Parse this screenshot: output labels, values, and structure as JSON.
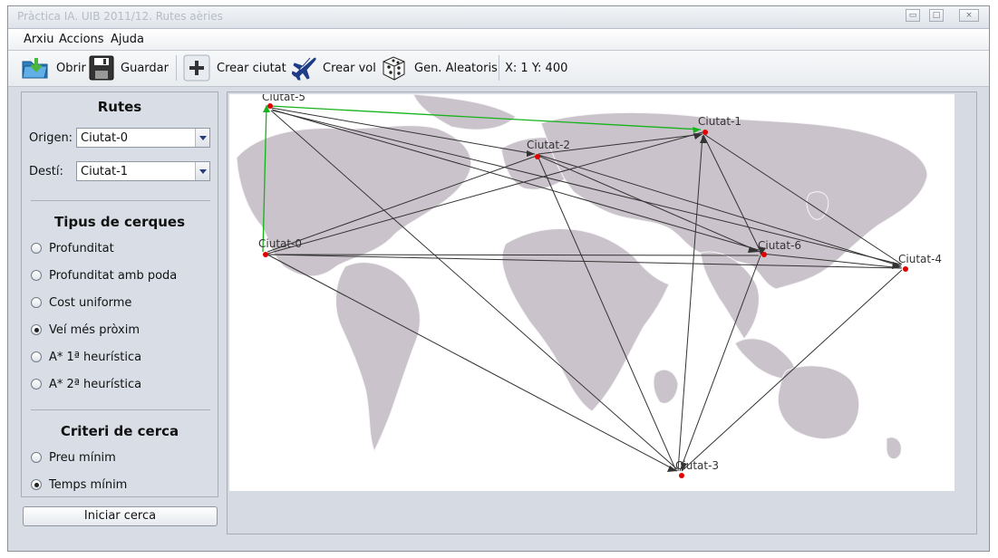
{
  "window": {
    "title": "Pràctica IA. UIB 2011/12. Rutes aèries",
    "controls": [
      "minimize",
      "maximize",
      "close"
    ]
  },
  "menu": [
    {
      "label": "Arxiu"
    },
    {
      "label": "Accions"
    },
    {
      "label": "Ajuda"
    }
  ],
  "toolbar": {
    "open_label": "Obrir",
    "save_label": "Guardar",
    "create_city_label": "Crear ciutat",
    "create_flight_label": "Crear vol",
    "random_label": "Gen. Aleatoris",
    "coordinates": "X: 1 Y: 400"
  },
  "sidebar": {
    "routes_title": "Rutes",
    "origin_label": "Origen:",
    "origin_value": "Ciutat-0",
    "destination_label": "Destí:",
    "destination_value": "Ciutat-1",
    "search_types_title": "Tipus de cerques",
    "search_types": [
      {
        "label": "Profunditat",
        "selected": false
      },
      {
        "label": "Profunditat amb poda",
        "selected": false
      },
      {
        "label": "Cost uniforme",
        "selected": false
      },
      {
        "label": "Veí més pròxim",
        "selected": true
      },
      {
        "label": "A* 1ª heurística",
        "selected": false
      },
      {
        "label": "A* 2ª heurística",
        "selected": false
      }
    ],
    "criteria_title": "Criteri de cerca",
    "criteria": [
      {
        "label": "Preu mínim",
        "selected": false
      },
      {
        "label": "Temps mínim",
        "selected": true
      }
    ],
    "start_button": "Iniciar cerca"
  },
  "map": {
    "cities": [
      {
        "label": "Ciutat-0"
      },
      {
        "label": "Ciutat-1"
      },
      {
        "label": "Ciutat-2"
      },
      {
        "label": "Ciutat-3"
      },
      {
        "label": "Ciutat-4"
      },
      {
        "label": "Ciutat-5"
      },
      {
        "label": "Ciutat-6"
      }
    ],
    "routes": [
      {
        "from": "Ciutat-0",
        "to": "Ciutat-5",
        "highlighted": true
      },
      {
        "from": "Ciutat-5",
        "to": "Ciutat-1",
        "highlighted": true
      },
      {
        "from": "Ciutat-5",
        "to": "Ciutat-2",
        "highlighted": false
      },
      {
        "from": "Ciutat-5",
        "to": "Ciutat-6",
        "highlighted": false
      },
      {
        "from": "Ciutat-5",
        "to": "Ciutat-4",
        "highlighted": false
      },
      {
        "from": "Ciutat-5",
        "to": "Ciutat-3",
        "highlighted": false
      },
      {
        "from": "Ciutat-0",
        "to": "Ciutat-2",
        "highlighted": false
      },
      {
        "from": "Ciutat-0",
        "to": "Ciutat-1",
        "highlighted": false
      },
      {
        "from": "Ciutat-0",
        "to": "Ciutat-6",
        "highlighted": false
      },
      {
        "from": "Ciutat-0",
        "to": "Ciutat-4",
        "highlighted": false
      },
      {
        "from": "Ciutat-0",
        "to": "Ciutat-3",
        "highlighted": false
      },
      {
        "from": "Ciutat-2",
        "to": "Ciutat-1",
        "highlighted": false
      },
      {
        "from": "Ciutat-2",
        "to": "Ciutat-6",
        "highlighted": false
      },
      {
        "from": "Ciutat-2",
        "to": "Ciutat-4",
        "highlighted": false
      },
      {
        "from": "Ciutat-2",
        "to": "Ciutat-3",
        "highlighted": false
      },
      {
        "from": "Ciutat-1",
        "to": "Ciutat-6",
        "highlighted": false
      },
      {
        "from": "Ciutat-1",
        "to": "Ciutat-4",
        "highlighted": false
      },
      {
        "from": "Ciutat-1",
        "to": "Ciutat-3",
        "highlighted": false
      },
      {
        "from": "Ciutat-6",
        "to": "Ciutat-3",
        "highlighted": false
      },
      {
        "from": "Ciutat-6",
        "to": "Ciutat-4",
        "highlighted": false
      },
      {
        "from": "Ciutat-3",
        "to": "Ciutat-4",
        "highlighted": false
      }
    ]
  },
  "colors": {
    "route": "#333333",
    "highlighted_route": "#16b21a",
    "city_marker": "#e00000",
    "land": "#cbc3cb",
    "background": "#d8dde5"
  }
}
